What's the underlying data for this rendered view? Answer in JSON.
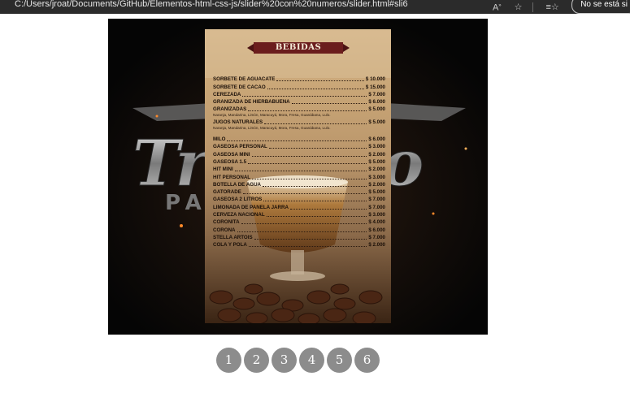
{
  "browser": {
    "url": "C:/Users/jroat/Documents/GitHub/Elementos-html-css-js/slider%20con%20numeros/slider.html#sli6",
    "status_label": "No se está si",
    "icons": [
      "read-aloud-icon",
      "favorite-add-icon",
      "favorites-icon",
      "collections-icon"
    ]
  },
  "slide": {
    "background_logo_text": "Troncho",
    "background_sub_text": "PA    AR",
    "menu": {
      "title": "BEBIDAS",
      "items": [
        {
          "name": "SORBETE DE AGUACATE",
          "price": "$ 10.000"
        },
        {
          "name": "SORBETE DE CACAO",
          "price": "$ 15.000"
        },
        {
          "name": "CEREZADA",
          "price": "$   7.000"
        },
        {
          "name": "GRANIZADA DE HIERBABUENA",
          "price": "$   6.000"
        },
        {
          "name": "GRANIZADAS",
          "price": "$   5.000",
          "note": "Naranja, Mandarina, Limón, Maracuyá, Mora, Fresa, Guanábana, Lulo."
        },
        {
          "name": "JUGOS NATURALES",
          "price": "$   5.000",
          "note": "Naranja, Mandarina, Limón, Maracuyá, Mora, Fresa, Guanábana, Lulo."
        },
        {
          "name": "MILO",
          "price": "$ 6.000",
          "gap_before": true
        },
        {
          "name": "GASEOSA PERSONAL",
          "price": "$ 3.000"
        },
        {
          "name": "GASEOSA MINI",
          "price": "$ 2.000"
        },
        {
          "name": "GASEOSA 1.5",
          "price": "$ 5.000"
        },
        {
          "name": "HIT MINI",
          "price": "$ 2.000"
        },
        {
          "name": "HIT PERSONAL",
          "price": "$ 3.000"
        },
        {
          "name": "BOTELLA DE AGUA",
          "price": "$ 2.000"
        },
        {
          "name": "GATORADE",
          "price": "$ 5.000"
        },
        {
          "name": "GASEOSA 2 LITROS",
          "price": "$ 7.000"
        },
        {
          "name": "LIMONADA DE PANELA JARRA",
          "price": "$ 7.000"
        },
        {
          "name": "CERVEZA NACIONAL",
          "price": "$ 3.000"
        },
        {
          "name": "CORONITA",
          "price": "$ 4.000"
        },
        {
          "name": "CORONA",
          "price": "$ 6.000"
        },
        {
          "name": "STELLA ARTOIS",
          "price": "$ 7.000"
        },
        {
          "name": "COLA Y POLA",
          "price": "$ 2.000"
        }
      ]
    }
  },
  "pager": [
    "1",
    "2",
    "3",
    "4",
    "5",
    "6"
  ],
  "colors": {
    "pager_dot": "#8c8c8c",
    "banner": "#6b1d1d",
    "slide_bg": "#050505"
  }
}
